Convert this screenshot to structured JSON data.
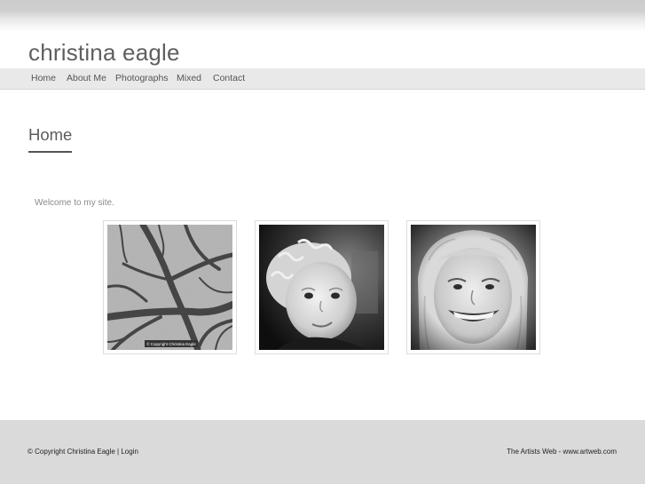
{
  "site": {
    "title": "christina eagle"
  },
  "nav": {
    "items": [
      {
        "label": "Home"
      },
      {
        "label": "About Me"
      },
      {
        "label": "Photographs"
      },
      {
        "label": "Mixed"
      },
      {
        "label": "Contact"
      }
    ]
  },
  "main": {
    "heading": "Home",
    "welcome": "Welcome to my site.",
    "thumbnails": [
      {
        "watermark": "© Copyright Christina Eagle"
      },
      {},
      {}
    ]
  },
  "footer": {
    "copyright": "© Copyright Christina Eagle",
    "separator": " | ",
    "login": "Login",
    "credit": "The Artists Web - www.artweb.com"
  },
  "colors": {
    "background": "#ffffff",
    "nav_background": "#e9e9e9",
    "footer_background": "#dadada",
    "title_text": "#5f5f5f"
  }
}
